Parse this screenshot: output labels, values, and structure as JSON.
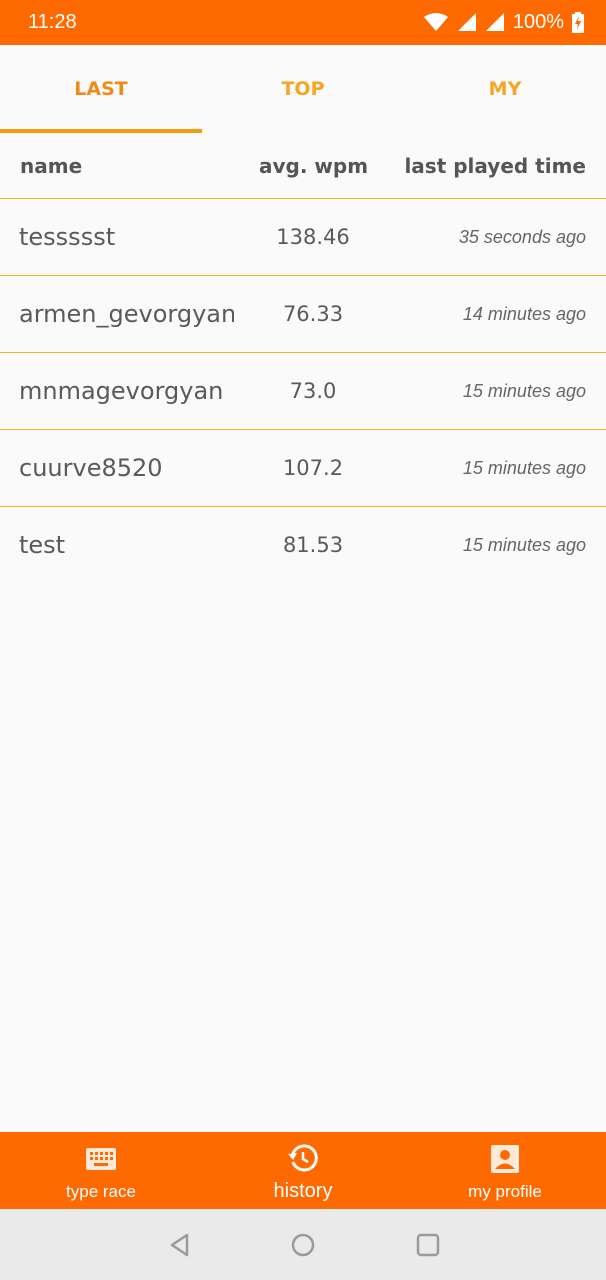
{
  "status_bar": {
    "time": "11:28",
    "battery": "100%",
    "icons": [
      "wifi-icon",
      "signal-icon",
      "signal-icon",
      "battery-charging-icon"
    ]
  },
  "tabs": [
    {
      "label": "LAST",
      "active": true
    },
    {
      "label": "TOP",
      "active": false
    },
    {
      "label": "MY",
      "active": false
    }
  ],
  "table": {
    "headers": {
      "name": "name",
      "wpm": "avg. wpm",
      "time": "last played time"
    },
    "rows": [
      {
        "name": "tessssst",
        "wpm": "138.46",
        "time": "35 seconds ago"
      },
      {
        "name": "armen_gevorgyan",
        "wpm": "76.33",
        "time": "14 minutes ago"
      },
      {
        "name": "mnmagevorgyan",
        "wpm": "73.0",
        "time": "15 minutes ago"
      },
      {
        "name": "cuurve8520",
        "wpm": "107.2",
        "time": "15 minutes ago"
      },
      {
        "name": "test",
        "wpm": "81.53",
        "time": "15 minutes ago"
      }
    ]
  },
  "bottom_nav": [
    {
      "label": "type race",
      "icon": "keyboard-icon"
    },
    {
      "label": "history",
      "icon": "history-icon"
    },
    {
      "label": "my profile",
      "icon": "account-box-icon"
    }
  ],
  "system_nav": [
    "back-icon",
    "home-icon",
    "recents-icon"
  ],
  "colors": {
    "accent": "#ff6a00",
    "tab_text": "#f5a623",
    "divider": "#f0b323",
    "background": "#fafafa"
  }
}
